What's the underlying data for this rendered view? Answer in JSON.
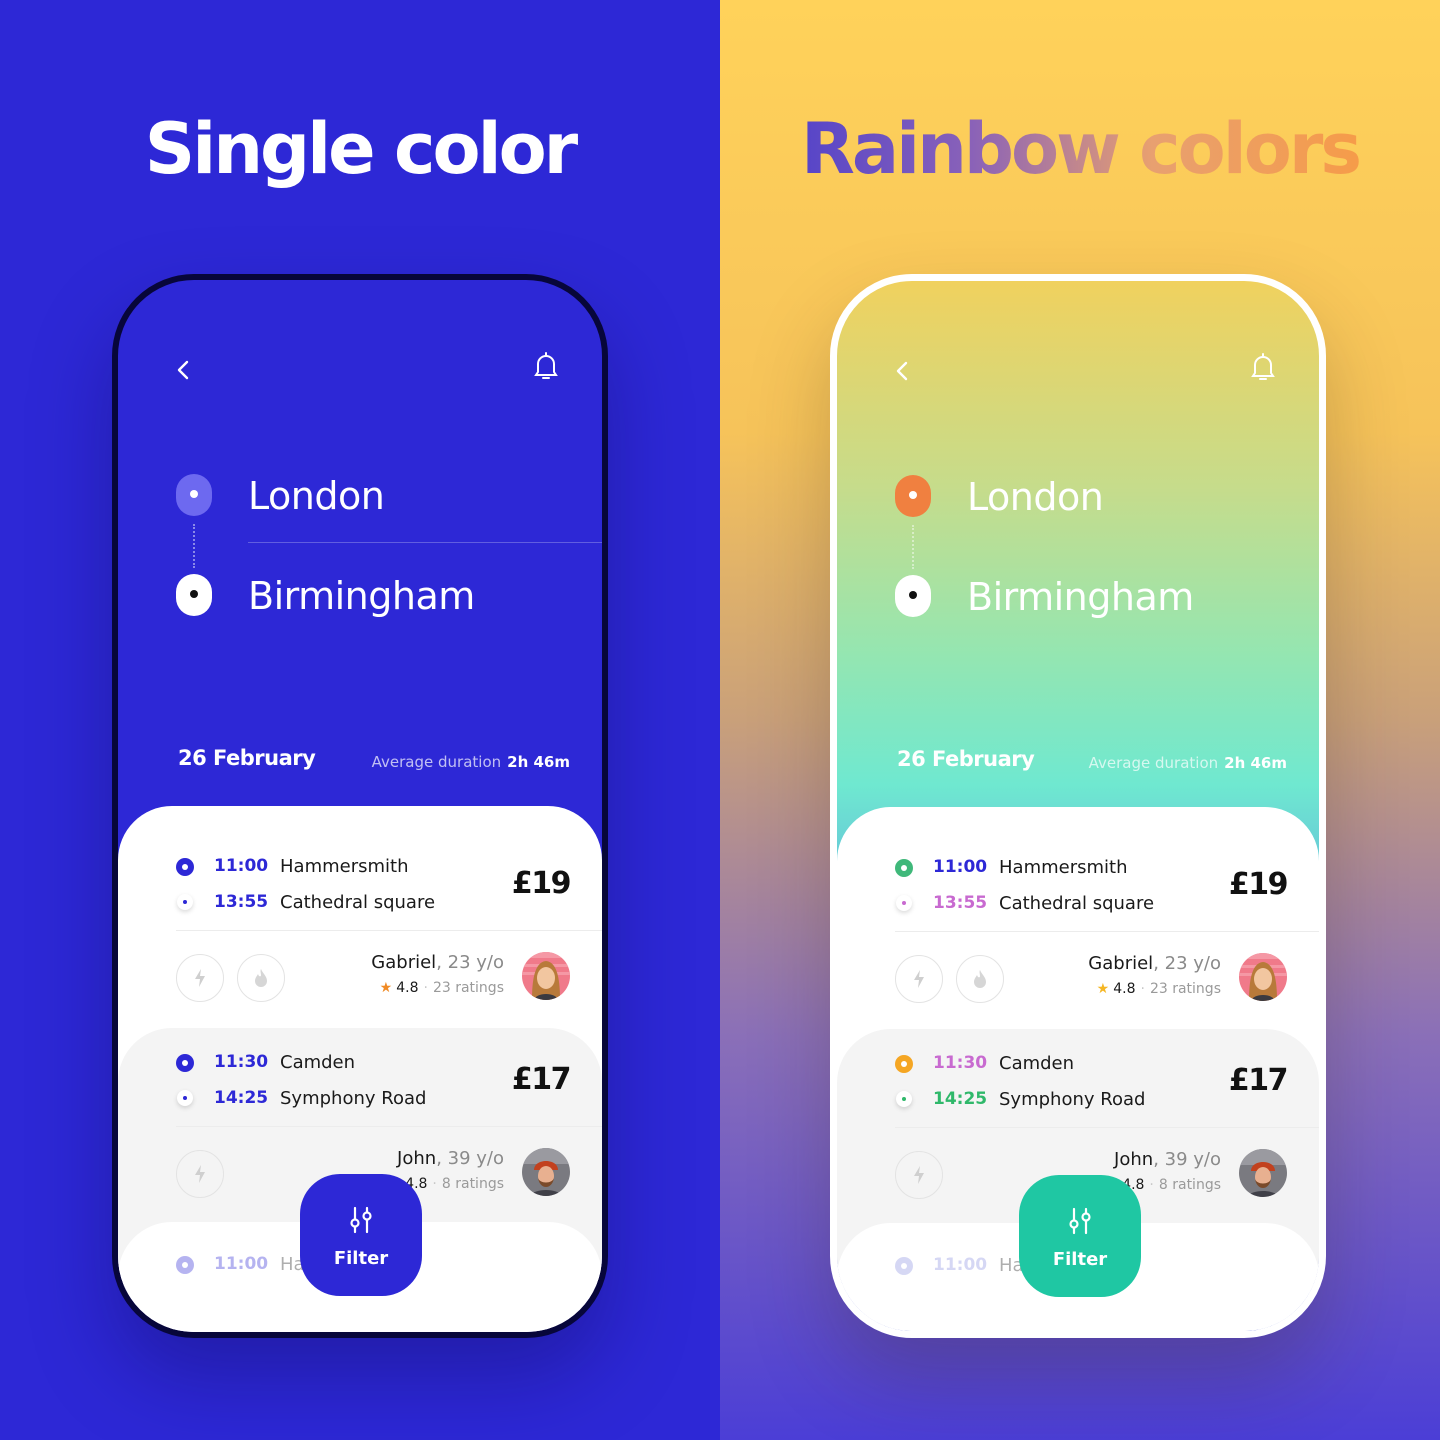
{
  "left": {
    "headline": "Single color",
    "accent": "#2d28d6",
    "trip": {
      "from": "London",
      "to": "Birmingham"
    },
    "date": "26 February",
    "duration_label": "Average duration",
    "duration_value": "2h 46m",
    "rides": [
      {
        "depart_time": "11:00",
        "depart_stop": "Hammersmith",
        "arrive_time": "13:55",
        "arrive_stop": "Cathedral square",
        "price": "£19",
        "driver": "Gabriel",
        "age": ", 23 y/o",
        "rating": "4.8",
        "ratings_count": "23 ratings"
      },
      {
        "depart_time": "11:30",
        "depart_stop": "Camden",
        "arrive_time": "14:25",
        "arrive_stop": "Symphony Road",
        "price": "£17",
        "driver": "John",
        "age": ", 39 y/o",
        "rating": "4.8",
        "ratings_count": "8 ratings"
      },
      {
        "depart_time": "11:00",
        "depart_stop": "Ha"
      }
    ],
    "filter_label": "Filter"
  },
  "right": {
    "headline": "Rainbow colors",
    "accent": "#1fc7a3",
    "trip": {
      "from": "London",
      "to": "Birmingham"
    },
    "date": "26 February",
    "duration_label": "Average duration",
    "duration_value": "2h 46m",
    "rides": [
      {
        "depart_time": "11:00",
        "depart_stop": "Hammersmith",
        "arrive_time": "13:55",
        "arrive_stop": "Cathedral square",
        "price": "£19",
        "driver": "Gabriel",
        "age": ", 23 y/o",
        "rating": "4.8",
        "ratings_count": "23 ratings"
      },
      {
        "depart_time": "11:30",
        "depart_stop": "Camden",
        "arrive_time": "14:25",
        "arrive_stop": "Symphony Road",
        "price": "£17",
        "driver": "John",
        "age": ", 39 y/o",
        "rating": "4.8",
        "ratings_count": "8 ratings"
      },
      {
        "depart_time": "11:00",
        "depart_stop": "Ha"
      }
    ],
    "filter_label": "Filter"
  },
  "colors": {
    "single_accent": "#2d28d6",
    "rainbow_from_node": "#f08040",
    "rainbow_ride1_depart": "#3fb87a",
    "rainbow_ride1_arrive": "#c86ad0",
    "rainbow_ride2_depart": "#f5a623",
    "rainbow_ride2_arrive": "#2fb86a",
    "rainbow_ride3_depart": "#8a8ee0",
    "filter_teal": "#1fc7a3"
  },
  "icons": [
    "back-chevron-icon",
    "bell-icon",
    "lightning-icon",
    "flame-icon",
    "star-icon",
    "filter-sliders-icon"
  ]
}
